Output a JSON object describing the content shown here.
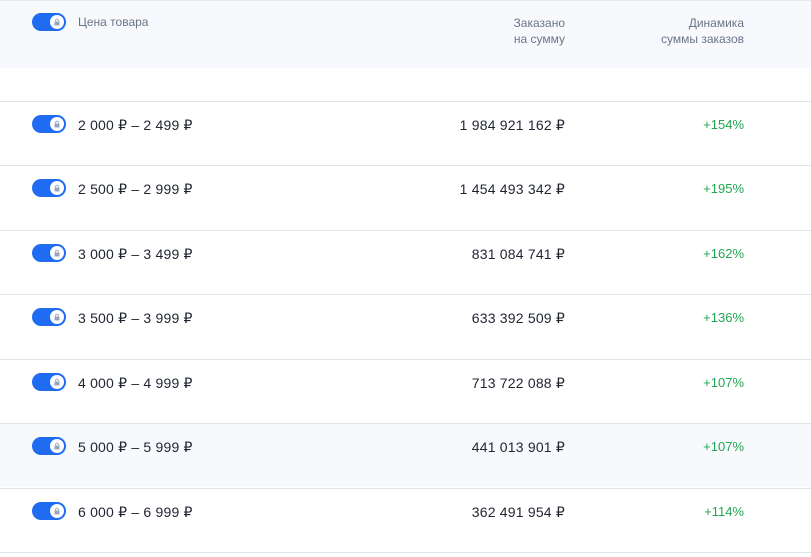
{
  "header": {
    "price_label": "Цена товара",
    "ordered_label_line1": "Заказано",
    "ordered_label_line2": "на сумму",
    "dynamics_label_line1": "Динамика",
    "dynamics_label_line2": "суммы заказов"
  },
  "colors": {
    "toggle_on": "#1f6bf2",
    "positive": "#22a652",
    "header_bg": "#f7f9fc"
  },
  "rows": [
    {
      "price": "2 000 ₽ – 2 499 ₽",
      "sum": "1 984 921 162 ₽",
      "dynamics": "+154%"
    },
    {
      "price": "2 500 ₽ – 2 999 ₽",
      "sum": "1 454 493 342 ₽",
      "dynamics": "+195%"
    },
    {
      "price": "3 000 ₽ – 3 499 ₽",
      "sum": "831 084 741 ₽",
      "dynamics": "+162%"
    },
    {
      "price": "3 500 ₽ – 3 999 ₽",
      "sum": "633 392 509 ₽",
      "dynamics": "+136%"
    },
    {
      "price": "4 000 ₽ – 4 999 ₽",
      "sum": "713 722 088 ₽",
      "dynamics": "+107%"
    },
    {
      "price": "5 000 ₽ – 5 999 ₽",
      "sum": "441 013 901 ₽",
      "dynamics": "+107%"
    },
    {
      "price": "6 000 ₽ – 6 999 ₽",
      "sum": "362 491 954 ₽",
      "dynamics": "+114%"
    }
  ]
}
